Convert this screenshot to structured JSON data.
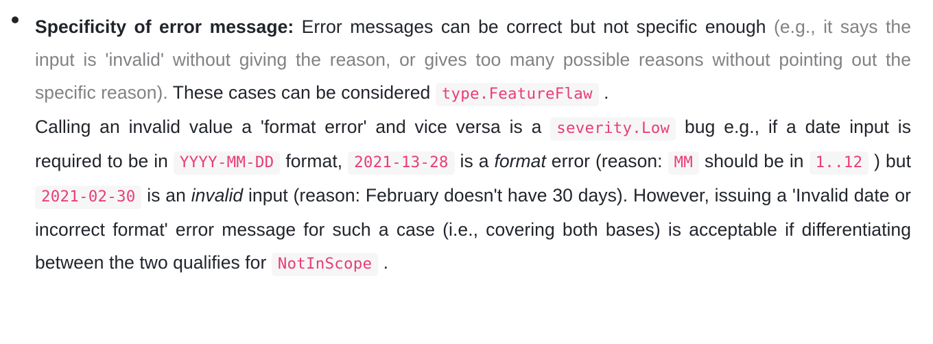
{
  "colors": {
    "text": "#21252b",
    "muted_text": "#808285",
    "code_text": "#ea3d74",
    "code_background": "#f6f6f7",
    "page_background": "#ffffff"
  },
  "bullet": {
    "marker": "bullet-dot"
  },
  "paragraph_1": {
    "lead_bold": "Specificity of error message",
    "after_bold_colon": ": ",
    "segment_normal_1": "Error messages can be correct but not specific enough ",
    "segment_muted": "(e.g., it says the input is 'invalid' without giving the reason, or gives too many possible reasons without pointing out the specific reason).",
    "segment_normal_2": " These cases can be considered ",
    "code_1": "type.FeatureFlaw",
    "segment_normal_3": " ."
  },
  "paragraph_2": {
    "t1": "Calling an invalid value a 'format error' and vice versa is a ",
    "code_1": "severity.Low",
    "t2": " bug e.g., if a date input is required to be in ",
    "code_2": "YYYY-MM-DD",
    "t3": " format, ",
    "code_3": "2021-13-28",
    "t4": " is a ",
    "italic_1": "format",
    "t5": " error (reason: ",
    "code_4": "MM",
    "t6": " should be in ",
    "code_5": "1..12",
    "t7": " ) but ",
    "code_6": "2021-02-30",
    "t8": " is an ",
    "italic_2": "invalid",
    "t9": " input (reason: February doesn't have 30 days). However, issuing a 'Invalid date or incorrect format' error message for such a case (i.e., covering both bases) is acceptable if differentiating between the two qualifies for ",
    "code_7": "NotInScope",
    "t10": " ."
  }
}
